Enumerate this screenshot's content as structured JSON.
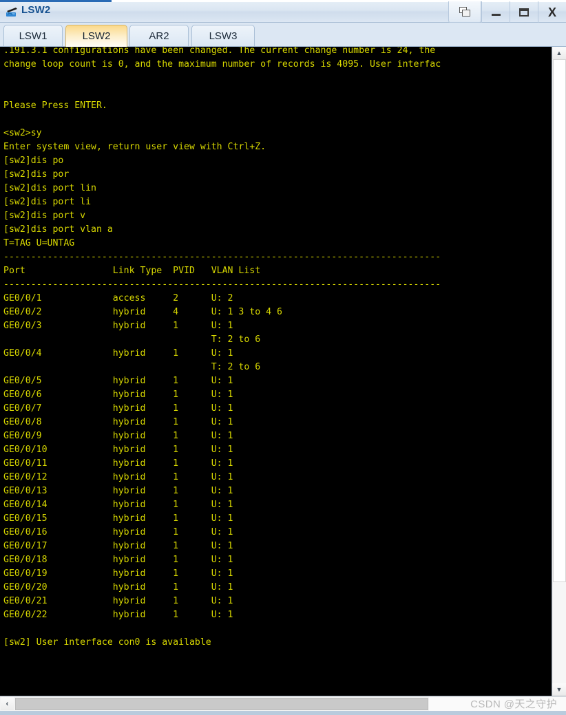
{
  "window": {
    "title": "LSW2",
    "icon": "switch-icon",
    "buttons": {
      "restore_label": "restore-window",
      "minimize_label": "—",
      "maximize_label": "maximize-window",
      "close_label": "X"
    }
  },
  "tabs": [
    {
      "label": "LSW1",
      "active": false
    },
    {
      "label": "LSW2",
      "active": true
    },
    {
      "label": "AR2",
      "active": false
    },
    {
      "label": "LSW3",
      "active": false
    }
  ],
  "colors": {
    "terminal_bg": "#000000",
    "terminal_fg": "#d8d800",
    "active_tab": "#fbd98a",
    "title_text": "#14508f"
  },
  "terminal": {
    "lines": [
      ".191.3.1 configurations have been changed. The current change number is 24, the",
      "change loop count is 0, and the maximum number of records is 4095. User interfac",
      "",
      "",
      "Please Press ENTER.",
      "",
      "<sw2>sy",
      "Enter system view, return user view with Ctrl+Z.",
      "[sw2]dis po",
      "[sw2]dis por",
      "[sw2]dis port lin",
      "[sw2]dis port li",
      "[sw2]dis port v",
      "[sw2]dis port vlan a",
      "T=TAG U=UNTAG",
      "--------------------------------------------------------------------------------",
      "Port                Link Type  PVID   VLAN List",
      "--------------------------------------------------------------------------------",
      "GE0/0/1             access     2      U: 2",
      "GE0/0/2             hybrid     4      U: 1 3 to 4 6",
      "GE0/0/3             hybrid     1      U: 1",
      "                                      T: 2 to 6",
      "GE0/0/4             hybrid     1      U: 1",
      "                                      T: 2 to 6",
      "GE0/0/5             hybrid     1      U: 1",
      "GE0/0/6             hybrid     1      U: 1",
      "GE0/0/7             hybrid     1      U: 1",
      "GE0/0/8             hybrid     1      U: 1",
      "GE0/0/9             hybrid     1      U: 1",
      "GE0/0/10            hybrid     1      U: 1",
      "GE0/0/11            hybrid     1      U: 1",
      "GE0/0/12            hybrid     1      U: 1",
      "GE0/0/13            hybrid     1      U: 1",
      "GE0/0/14            hybrid     1      U: 1",
      "GE0/0/15            hybrid     1      U: 1",
      "GE0/0/16            hybrid     1      U: 1",
      "GE0/0/17            hybrid     1      U: 1",
      "GE0/0/18            hybrid     1      U: 1",
      "GE0/0/19            hybrid     1      U: 1",
      "GE0/0/20            hybrid     1      U: 1",
      "GE0/0/21            hybrid     1      U: 1",
      "GE0/0/22            hybrid     1      U: 1",
      "",
      "[sw2] User interface con0 is available"
    ]
  },
  "port_table": {
    "legend": "T=TAG U=UNTAG",
    "columns": [
      "Port",
      "Link Type",
      "PVID",
      "VLAN List"
    ],
    "rows": [
      {
        "port": "GE0/0/1",
        "link_type": "access",
        "pvid": "2",
        "untagged": "U: 2",
        "tagged": ""
      },
      {
        "port": "GE0/0/2",
        "link_type": "hybrid",
        "pvid": "4",
        "untagged": "U: 1 3 to 4 6",
        "tagged": ""
      },
      {
        "port": "GE0/0/3",
        "link_type": "hybrid",
        "pvid": "1",
        "untagged": "U: 1",
        "tagged": "T: 2 to 6"
      },
      {
        "port": "GE0/0/4",
        "link_type": "hybrid",
        "pvid": "1",
        "untagged": "U: 1",
        "tagged": "T: 2 to 6"
      },
      {
        "port": "GE0/0/5",
        "link_type": "hybrid",
        "pvid": "1",
        "untagged": "U: 1",
        "tagged": ""
      },
      {
        "port": "GE0/0/6",
        "link_type": "hybrid",
        "pvid": "1",
        "untagged": "U: 1",
        "tagged": ""
      },
      {
        "port": "GE0/0/7",
        "link_type": "hybrid",
        "pvid": "1",
        "untagged": "U: 1",
        "tagged": ""
      },
      {
        "port": "GE0/0/8",
        "link_type": "hybrid",
        "pvid": "1",
        "untagged": "U: 1",
        "tagged": ""
      },
      {
        "port": "GE0/0/9",
        "link_type": "hybrid",
        "pvid": "1",
        "untagged": "U: 1",
        "tagged": ""
      },
      {
        "port": "GE0/0/10",
        "link_type": "hybrid",
        "pvid": "1",
        "untagged": "U: 1",
        "tagged": ""
      },
      {
        "port": "GE0/0/11",
        "link_type": "hybrid",
        "pvid": "1",
        "untagged": "U: 1",
        "tagged": ""
      },
      {
        "port": "GE0/0/12",
        "link_type": "hybrid",
        "pvid": "1",
        "untagged": "U: 1",
        "tagged": ""
      },
      {
        "port": "GE0/0/13",
        "link_type": "hybrid",
        "pvid": "1",
        "untagged": "U: 1",
        "tagged": ""
      },
      {
        "port": "GE0/0/14",
        "link_type": "hybrid",
        "pvid": "1",
        "untagged": "U: 1",
        "tagged": ""
      },
      {
        "port": "GE0/0/15",
        "link_type": "hybrid",
        "pvid": "1",
        "untagged": "U: 1",
        "tagged": ""
      },
      {
        "port": "GE0/0/16",
        "link_type": "hybrid",
        "pvid": "1",
        "untagged": "U: 1",
        "tagged": ""
      },
      {
        "port": "GE0/0/17",
        "link_type": "hybrid",
        "pvid": "1",
        "untagged": "U: 1",
        "tagged": ""
      },
      {
        "port": "GE0/0/18",
        "link_type": "hybrid",
        "pvid": "1",
        "untagged": "U: 1",
        "tagged": ""
      },
      {
        "port": "GE0/0/19",
        "link_type": "hybrid",
        "pvid": "1",
        "untagged": "U: 1",
        "tagged": ""
      },
      {
        "port": "GE0/0/20",
        "link_type": "hybrid",
        "pvid": "1",
        "untagged": "U: 1",
        "tagged": ""
      },
      {
        "port": "GE0/0/21",
        "link_type": "hybrid",
        "pvid": "1",
        "untagged": "U: 1",
        "tagged": ""
      },
      {
        "port": "GE0/0/22",
        "link_type": "hybrid",
        "pvid": "1",
        "untagged": "U: 1",
        "tagged": ""
      }
    ]
  },
  "scrollbars": {
    "vertical_up": "▲",
    "vertical_down": "▼",
    "horizontal_left": "‹"
  },
  "watermark": "CSDN @天之守护"
}
